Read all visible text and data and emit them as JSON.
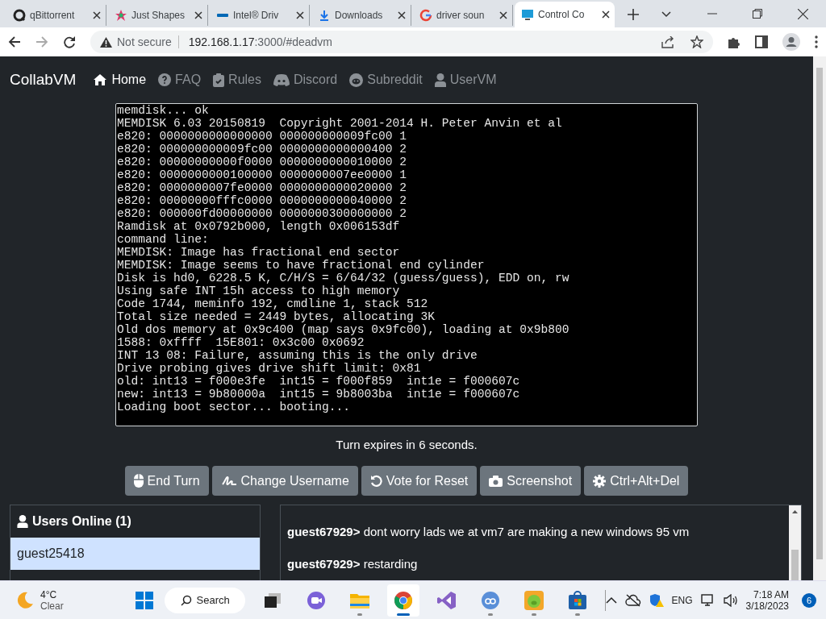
{
  "browser": {
    "tabs": [
      {
        "title": "qBittorrent",
        "kind": "qbit",
        "selected": false
      },
      {
        "title": "Just Shapes",
        "kind": "shapes",
        "selected": false
      },
      {
        "title": "Intel® Driv",
        "kind": "intel",
        "selected": false
      },
      {
        "title": "Downloads",
        "kind": "download",
        "selected": false
      },
      {
        "title": "driver soun",
        "kind": "google",
        "selected": false
      },
      {
        "title": "Control Co",
        "kind": "monitor",
        "selected": true
      }
    ],
    "security": "Not secure",
    "host": "192.168.1.17",
    "path": ":3000/#deadvm"
  },
  "navbar": {
    "brand": "CollabVM",
    "links": [
      {
        "label": "Home",
        "kind": "home",
        "selected": true
      },
      {
        "label": "FAQ",
        "kind": "faq",
        "selected": false
      },
      {
        "label": "Rules",
        "kind": "rules",
        "selected": false
      },
      {
        "label": "Discord",
        "kind": "discord",
        "selected": false
      },
      {
        "label": "Subreddit",
        "kind": "reddit",
        "selected": false
      },
      {
        "label": "UserVM",
        "kind": "user",
        "selected": false
      }
    ]
  },
  "screen": {
    "lines": [
      "memdisk... ok",
      "MEMDISK 6.03 20150819  Copyright 2001-2014 H. Peter Anvin et al",
      "e820: 0000000000000000 000000000009fc00 1",
      "e820: 000000000009fc00 0000000000000400 2",
      "e820: 00000000000f0000 0000000000010000 2",
      "e820: 0000000000100000 0000000007ee0000 1",
      "e820: 0000000007fe0000 0000000000020000 2",
      "e820: 00000000fffc0000 0000000000040000 2",
      "e820: 000000fd00000000 0000000300000000 2",
      "Ramdisk at 0x0792b000, length 0x006153df",
      "command line:",
      "MEMDISK: Image has fractional end sector",
      "MEMDISK: Image seems to have fractional end cylinder",
      "Disk is hd0, 6228.5 K, C/H/S = 6/64/32 (guess/guess), EDD on, rw",
      "Using safe INT 15h access to high memory",
      "Code 1744, meminfo 192, cmdline 1, stack 512",
      "Total size needed = 2449 bytes, allocating 3K",
      "Old dos memory at 0x9c400 (map says 0x9fc00), loading at 0x9b800",
      "1588: 0xffff  15E801: 0x3c00 0x0692",
      "INT 13 08: Failure, assuming this is the only drive",
      "Drive probing gives drive shift limit: 0x81",
      "old: int13 = f000e3fe  int15 = f000f859  int1e = f000607c",
      "new: int13 = 9b80000a  int15 = 9b8003ba  int1e = f000607c",
      "Loading boot sector... booting..."
    ]
  },
  "turn_status": "Turn expires in 6 seconds.",
  "buttons": [
    {
      "label": "End Turn",
      "kind": "mouse"
    },
    {
      "label": "Change Username",
      "kind": "signature"
    },
    {
      "label": "Vote for Reset",
      "kind": "reset"
    },
    {
      "label": "Screenshot",
      "kind": "camera"
    },
    {
      "label": "Ctrl+Alt+Del",
      "kind": "gear"
    }
  ],
  "users": {
    "title": "Users Online (1)",
    "list": [
      {
        "name": "guest25418",
        "selected": true
      }
    ]
  },
  "chat": {
    "messages": [
      {
        "user": "guest67929>",
        "text": "dont worry lads we at vm7 are making a new windows 95 vm"
      },
      {
        "user": "guest67929>",
        "text": "restarding"
      }
    ]
  },
  "taskbar": {
    "weather": {
      "temp": "4°C",
      "condition": "Clear"
    },
    "search": "Search",
    "apps": [
      {
        "kind": "taskview",
        "running": false,
        "selected": false
      },
      {
        "kind": "meet",
        "running": false,
        "selected": false
      },
      {
        "kind": "folder",
        "running": true,
        "selected": false
      },
      {
        "kind": "chrome",
        "running": true,
        "selected": true
      },
      {
        "kind": "vs",
        "running": false,
        "selected": false
      },
      {
        "kind": "qb",
        "running": true,
        "selected": false
      },
      {
        "kind": "game",
        "running": true,
        "selected": false
      },
      {
        "kind": "store",
        "running": true,
        "selected": false
      }
    ],
    "language": "ENG",
    "time": "7:18 AM",
    "date": "3/18/2023",
    "notifications": "6"
  }
}
